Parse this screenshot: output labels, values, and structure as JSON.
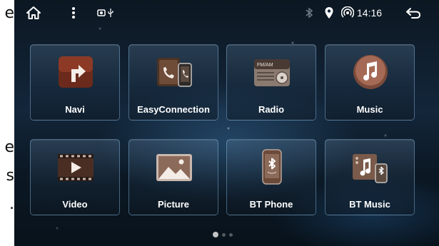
{
  "side_text": [
    "e",
    "e",
    "s",
    "."
  ],
  "status": {
    "time": "14:16",
    "icons": [
      "home-icon",
      "more-vert-icon",
      "camera-icon",
      "usb-icon",
      "bluetooth-icon",
      "location-icon",
      "wifi-hotspot-icon",
      "back-icon"
    ]
  },
  "apps": [
    {
      "label": "Navi",
      "icon": "navi-icon"
    },
    {
      "label": "EasyConnection",
      "icon": "easyconnection-icon"
    },
    {
      "label": "Radio",
      "icon": "radio-icon"
    },
    {
      "label": "Music",
      "icon": "music-icon"
    },
    {
      "label": "Video",
      "icon": "video-icon"
    },
    {
      "label": "Picture",
      "icon": "picture-icon"
    },
    {
      "label": "BT Phone",
      "icon": "bt-phone-icon"
    },
    {
      "label": "BT Music",
      "icon": "bt-music-icon"
    }
  ],
  "radio_band": "FM/AM",
  "pager": {
    "pages": 3,
    "current": 1
  },
  "colors": {
    "tile_border": "#8cbee6",
    "background": "#0c1722",
    "text": "#ffffff"
  }
}
